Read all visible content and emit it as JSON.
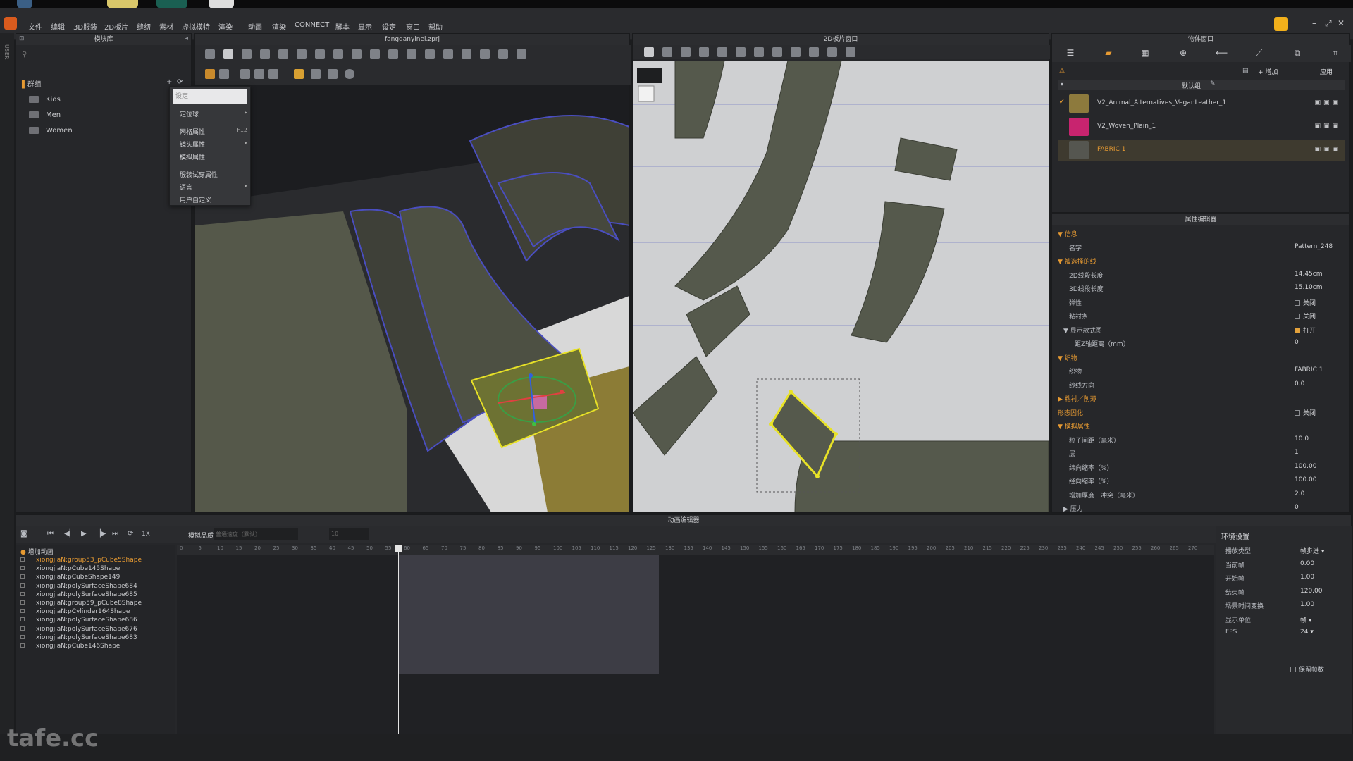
{
  "menubar": {
    "items": [
      "文件",
      "编辑",
      "3D服装",
      "2D板片",
      "缝纫",
      "素材",
      "虚拟模特",
      "渲染",
      "动画",
      "渲染",
      "CONNECT",
      "脚本",
      "显示",
      "设定",
      "窗口",
      "帮助"
    ],
    "win_min": "–",
    "win_max": "⤢",
    "win_close": "✕"
  },
  "sidebar_tab": "USER",
  "library": {
    "title": "模块库",
    "group": "群组",
    "folders": [
      "Kids",
      "Men",
      "Women"
    ],
    "add": "+",
    "refresh": "⟳"
  },
  "context_menu": {
    "input_placeholder": "设定",
    "items": [
      {
        "label": "定位球",
        "sub": "▸"
      },
      {
        "label": "网格属性",
        "sub": "F12"
      },
      {
        "label": "镜头属性",
        "sub": "▸"
      },
      {
        "label": "模拟属性",
        "sub": ""
      },
      {
        "label": "服装试穿属性",
        "sub": ""
      },
      {
        "label": "语言",
        "sub": "▸"
      },
      {
        "label": "用户自定义",
        "sub": ""
      }
    ]
  },
  "viewport3d": {
    "title": "fangdanyinei.zprj"
  },
  "viewport2d": {
    "title": "2D板片窗口"
  },
  "object_window": {
    "title": "物体窗口",
    "add": "+ 增加",
    "apply": "应用",
    "default_group": "默认组",
    "fabrics": [
      {
        "name": "V2_Animal_Alternatives_VeganLeather_1",
        "color": "#8d7a3d",
        "selected": false
      },
      {
        "name": "V2_Woven_Plain_1",
        "color": "#c8246f",
        "selected": false
      },
      {
        "name": "FABRIC 1",
        "color": "#555650",
        "selected": true
      }
    ],
    "checkmark": "✔",
    "row_icons": "▣▣▣"
  },
  "property_editor": {
    "title": "属性编辑器",
    "rows": [
      {
        "k": "▼ 信息",
        "v": "",
        "sec": true,
        "ind": 0
      },
      {
        "k": "名字",
        "v": "Pattern_248",
        "sec": false,
        "ind": 2
      },
      {
        "k": "▼ 被选择的线",
        "v": "",
        "sec": true,
        "ind": 0
      },
      {
        "k": "2D线段长度",
        "v": "14.45cm",
        "sec": false,
        "ind": 2
      },
      {
        "k": "3D线段长度",
        "v": "15.10cm",
        "sec": false,
        "ind": 2
      },
      {
        "k": "弹性",
        "v": "关闭",
        "sec": false,
        "ind": 2,
        "chk": false
      },
      {
        "k": "粘衬条",
        "v": "关闭",
        "sec": false,
        "ind": 2,
        "chk": false
      },
      {
        "k": "▼ 显示款式图",
        "v": "打开",
        "sec": false,
        "ind": 1,
        "chk": true
      },
      {
        "k": "距Z轴距离（mm）",
        "v": "0",
        "sec": false,
        "ind": 3
      },
      {
        "k": "▼ 织物",
        "v": "",
        "sec": true,
        "ind": 0
      },
      {
        "k": "织物",
        "v": "FABRIC 1",
        "sec": false,
        "ind": 2
      },
      {
        "k": "纱线方向",
        "v": "0.0",
        "sec": false,
        "ind": 2
      },
      {
        "k": "▶ 粘衬／削薄",
        "v": "",
        "sec": true,
        "ind": 0
      },
      {
        "k": "形态固化",
        "v": "关闭",
        "sec": true,
        "ind": 0,
        "chk": false
      },
      {
        "k": "▼ 模拟属性",
        "v": "",
        "sec": true,
        "ind": 0
      },
      {
        "k": "粒子间距（毫米）",
        "v": "10.0",
        "sec": false,
        "ind": 2
      },
      {
        "k": "层",
        "v": "1",
        "sec": false,
        "ind": 2
      },
      {
        "k": "纬向缩率（%）",
        "v": "100.00",
        "sec": false,
        "ind": 2
      },
      {
        "k": "经向缩率（%）",
        "v": "100.00",
        "sec": false,
        "ind": 2
      },
      {
        "k": "增加厚度－冲突（毫米）",
        "v": "2.0",
        "sec": false,
        "ind": 2
      },
      {
        "k": "▶ 压力",
        "v": "0",
        "sec": false,
        "ind": 1
      }
    ]
  },
  "animation": {
    "title": "动画编辑器",
    "quality_label": "模拟品质",
    "quality_value": "普通速度（默认）",
    "speed": "1X",
    "add_anim": "增加动画",
    "frame_count": "10",
    "tracks": [
      "xiongjiaN:group53_pCube5Shape",
      "xiongjiaN:pCube145Shape",
      "xiongjiaN:pCubeShape149",
      "xiongjiaN:polySurfaceShape684",
      "xiongjiaN:polySurfaceShape685",
      "xiongjiaN:group59_pCube8Shape",
      "xiongjiaN:pCylinder164Shape",
      "xiongjiaN:polySurfaceShape686",
      "xiongjiaN:polySurfaceShape676",
      "xiongjiaN:polySurfaceShape683",
      "xiongjiaN:pCube146Shape"
    ],
    "ruler": [
      "0",
      "5",
      "10",
      "15",
      "20",
      "25",
      "30",
      "35",
      "40",
      "45",
      "50",
      "55",
      "60",
      "65",
      "70",
      "75",
      "80",
      "85",
      "90",
      "95",
      "100",
      "105",
      "110",
      "115",
      "120",
      "125",
      "130",
      "135",
      "140",
      "145",
      "150",
      "155",
      "160",
      "165",
      "170",
      "175",
      "180",
      "185",
      "190",
      "195",
      "200",
      "205",
      "210",
      "215",
      "220",
      "225",
      "230",
      "235",
      "240",
      "245",
      "250",
      "255",
      "260",
      "265",
      "270"
    ],
    "env": {
      "title": "环境设置",
      "rows": [
        {
          "k": "播放类型",
          "v": "帧步进 ▾"
        },
        {
          "k": "当前帧",
          "v": "0.00"
        },
        {
          "k": "开始帧",
          "v": "1.00"
        },
        {
          "k": "结束帧",
          "v": "120.00"
        },
        {
          "k": "场景时间变换",
          "v": "1.00"
        },
        {
          "k": "显示单位",
          "v": "帧 ▾"
        },
        {
          "k": "FPS",
          "v": "24 ▾"
        }
      ],
      "keep_frames": "保留帧数"
    }
  },
  "watermark": "tafe.cc",
  "colors": {
    "accent": "#e69a32",
    "selection": "#e8e227",
    "gizmo_red": "#e04040",
    "gizmo_blue": "#3060e0",
    "gizmo_green": "#40c040",
    "fabric": "#555a4d"
  }
}
